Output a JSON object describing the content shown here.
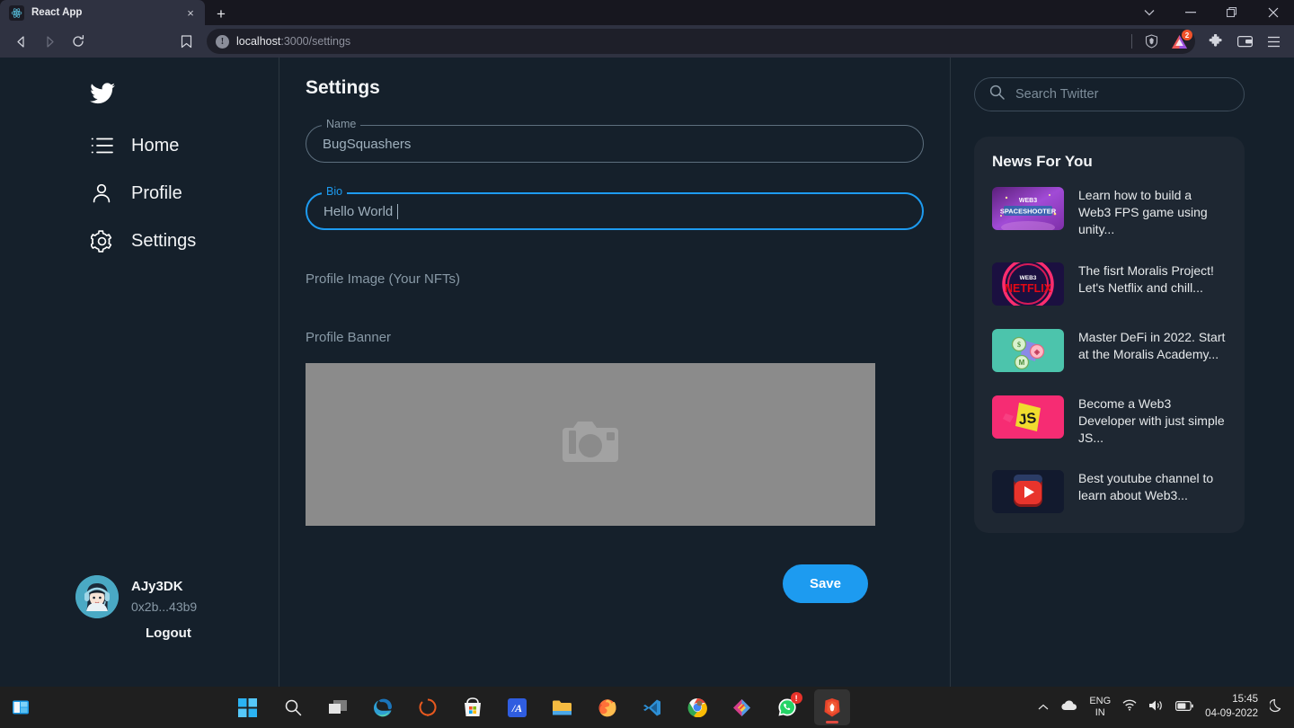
{
  "browser": {
    "tab": {
      "title": "React App",
      "icon": "react-icon",
      "close_label": "×"
    },
    "new_tab_label": "+",
    "window_controls": {
      "tab_search": "⌄",
      "minimize": "–",
      "restore": "❐",
      "close": "✕"
    },
    "omnibox": {
      "info_icon": "!",
      "url_host": "localhost",
      "url_path": ":3000/settings",
      "full_url": "localhost:3000/settings"
    },
    "extension_badge_count": "2"
  },
  "sidebar": {
    "logo": "twitter-bird-icon",
    "items": [
      {
        "label": "Home",
        "icon": "list-icon"
      },
      {
        "label": "Profile",
        "icon": "person-icon"
      },
      {
        "label": "Settings",
        "icon": "gear-icon"
      }
    ],
    "user": {
      "name": "AJy3DK",
      "address": "0x2b...43b9",
      "logout_label": "Logout"
    }
  },
  "main": {
    "title": "Settings",
    "fields": [
      {
        "legend": "Name",
        "value": "BugSquashers",
        "focused": false
      },
      {
        "legend": "Bio",
        "value": "Hello World",
        "focused": true
      }
    ],
    "profile_image_label": "Profile Image (Your NFTs)",
    "profile_banner_label": "Profile Banner",
    "banner_placeholder_icon": "camera-icon",
    "save_label": "Save",
    "accent_color": "#1d9bf0"
  },
  "right": {
    "search": {
      "placeholder": "Search Twitter",
      "icon": "search-icon"
    },
    "news_title": "News For You",
    "news_items": [
      {
        "text": "Learn how to build a Web3 FPS game using unity...",
        "thumb": "web3-space-shooter-thumb"
      },
      {
        "text": "The fisrt Moralis Project! Let's Netflix and chill...",
        "thumb": "web3-netflix-thumb"
      },
      {
        "text": "Master DeFi in 2022. Start at the Moralis Academy...",
        "thumb": "defi-coins-thumb"
      },
      {
        "text": "Become a Web3 Developer with just simple JS...",
        "thumb": "js-logo-thumb"
      },
      {
        "text": "Best youtube channel to learn about Web3...",
        "thumb": "youtube-thumb"
      }
    ]
  },
  "taskbar": {
    "apps": [
      {
        "name": "start"
      },
      {
        "name": "search"
      },
      {
        "name": "task-view"
      },
      {
        "name": "edge"
      },
      {
        "name": "orange-app"
      },
      {
        "name": "microsoft-store"
      },
      {
        "name": "blue-app"
      },
      {
        "name": "file-explorer"
      },
      {
        "name": "firefox"
      },
      {
        "name": "vscode"
      },
      {
        "name": "chrome"
      },
      {
        "name": "multicolor-app"
      },
      {
        "name": "whatsapp",
        "badge": "!"
      },
      {
        "name": "brave",
        "active": true
      }
    ],
    "tray": {
      "language_top": "ENG",
      "language_bottom": "IN",
      "time": "15:45",
      "date": "04-09-2022"
    }
  }
}
